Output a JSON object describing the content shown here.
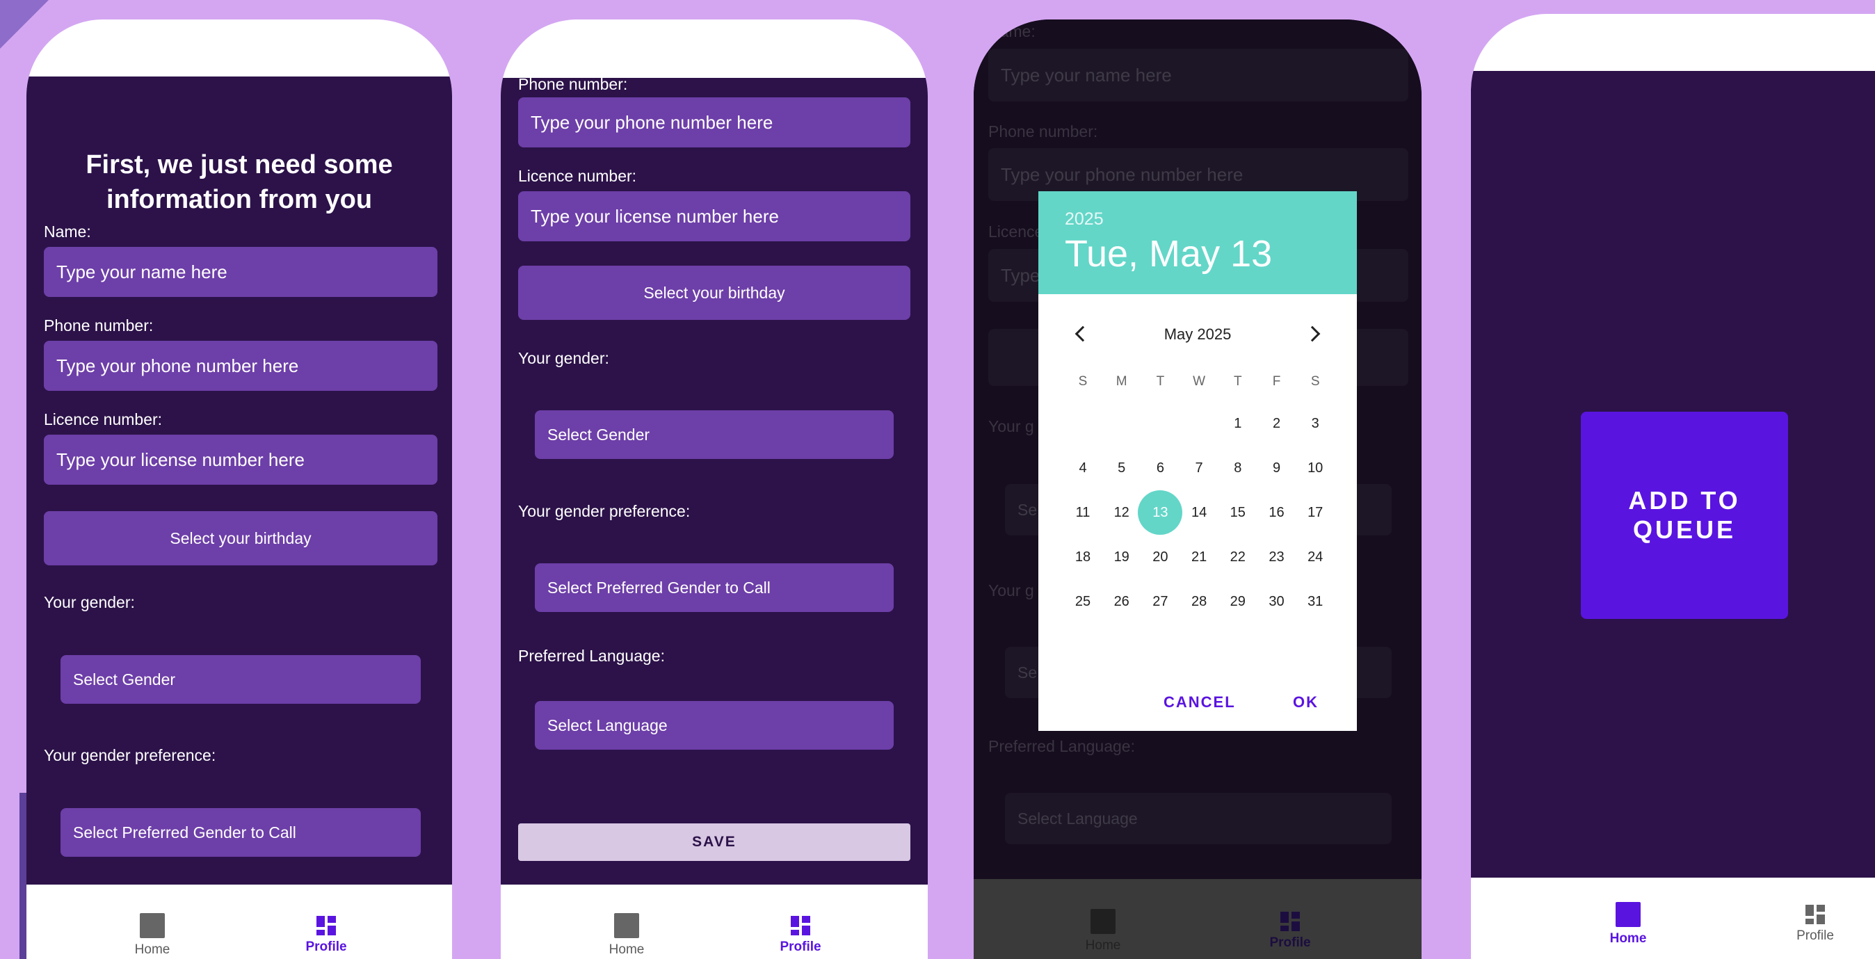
{
  "colors": {
    "background": "#d4a6f2",
    "screen": "#2c1249",
    "field": "#6d3fa8",
    "accent": "#5a14e0",
    "calendar_accent": "#63d6c8"
  },
  "icons": {
    "home": "square-icon",
    "profile": "dashboard-icon",
    "prev": "chevron-left-icon",
    "next": "chevron-right-icon"
  },
  "screen1": {
    "title": "First, we just need some information from you",
    "name_label": "Name:",
    "name_placeholder": "Type your name here",
    "phone_label": "Phone number:",
    "phone_placeholder": "Type your phone number here",
    "licence_label": "Licence number:",
    "licence_placeholder": "Type your license number here",
    "birthday_button": "Select your birthday",
    "gender_label": "Your gender:",
    "gender_select": "Select Gender",
    "pref_label": "Your gender preference:",
    "pref_select": "Select Preferred Gender to Call"
  },
  "screen2": {
    "phone_label": "Phone number:",
    "phone_placeholder": "Type your phone number here",
    "licence_label": "Licence number:",
    "licence_placeholder": "Type your license number here",
    "birthday_button": "Select your birthday",
    "gender_label": "Your gender:",
    "gender_select": "Select Gender",
    "pref_label": "Your gender preference:",
    "pref_select": "Select Preferred Gender to Call",
    "language_label": "Preferred Language:",
    "language_select": "Select Language",
    "save_button": "SAVE"
  },
  "screen3": {
    "name_label": "Name:",
    "name_placeholder": "Type your name here",
    "phone_label": "Phone number:",
    "phone_placeholder": "Type your phone number here",
    "licence_label_partial": "Licence",
    "licence_placeholder_partial": "Type",
    "gender_label_partial": "Your g",
    "gender_select_partial": "Se",
    "pref_label_partial": "Your g",
    "pref_select_partial": "Se",
    "language_label": "Preferred Language:",
    "language_select": "Select Language"
  },
  "datepicker": {
    "year": "2025",
    "date": "Tue, May 13",
    "month": "May 2025",
    "weekdays": [
      "S",
      "M",
      "T",
      "W",
      "T",
      "F",
      "S"
    ],
    "days": [
      "1",
      "2",
      "3",
      "4",
      "5",
      "6",
      "7",
      "8",
      "9",
      "10",
      "11",
      "12",
      "13",
      "14",
      "15",
      "16",
      "17",
      "18",
      "19",
      "20",
      "21",
      "22",
      "23",
      "24",
      "25",
      "26",
      "27",
      "28",
      "29",
      "30",
      "31"
    ],
    "first_weekday": 4,
    "selected": "13",
    "cancel": "CANCEL",
    "ok": "OK"
  },
  "screen4": {
    "queue_button": "ADD TO QUEUE"
  },
  "nav": {
    "home": "Home",
    "profile": "Profile"
  }
}
